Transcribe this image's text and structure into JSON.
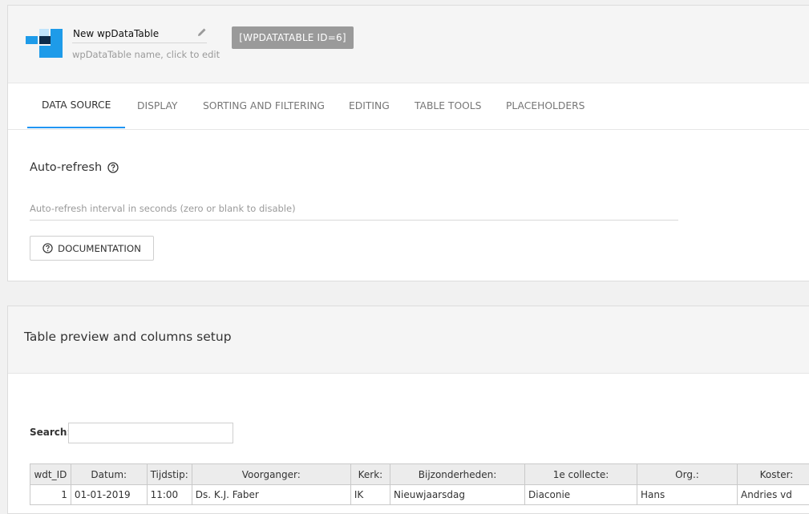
{
  "header": {
    "table_name": "New wpDataTable",
    "table_name_hint": "wpDataTable name, click to edit",
    "shortcode": "[WPDATATABLE ID=6]"
  },
  "tabs": [
    {
      "label": "DATA SOURCE",
      "active": true
    },
    {
      "label": "DISPLAY",
      "active": false
    },
    {
      "label": "SORTING AND FILTERING",
      "active": false
    },
    {
      "label": "EDITING",
      "active": false
    },
    {
      "label": "TABLE TOOLS",
      "active": false
    },
    {
      "label": "PLACEHOLDERS",
      "active": false
    }
  ],
  "auto_refresh": {
    "title": "Auto-refresh",
    "placeholder": "Auto-refresh interval in seconds (zero or blank to disable)",
    "value": "",
    "doc_button": "DOCUMENTATION"
  },
  "preview": {
    "title": "Table preview and columns setup",
    "search_label": "Search:",
    "search_value": "",
    "columns": [
      "wdt_ID",
      "Datum:",
      "Tijdstip:",
      "Voorganger:",
      "Kerk:",
      "Bijzonderheden:",
      "1e collecte:",
      "Org.:",
      "Koster:"
    ],
    "rows": [
      [
        "1",
        "01-01-2019",
        "11:00",
        "Ds. K.J. Faber",
        "IK",
        "Nieuwjaarsdag",
        "Diaconie",
        "Hans",
        "Andries vd"
      ]
    ]
  },
  "colors": {
    "accent": "#2196f3",
    "shortcode_bg": "#9a9a9a",
    "logo_primary": "#1e9be9",
    "logo_dark": "#0d2b4a"
  },
  "icons": {
    "logo": "wpdatatables-logo",
    "edit": "pencil-icon",
    "help": "question-circle-icon"
  }
}
